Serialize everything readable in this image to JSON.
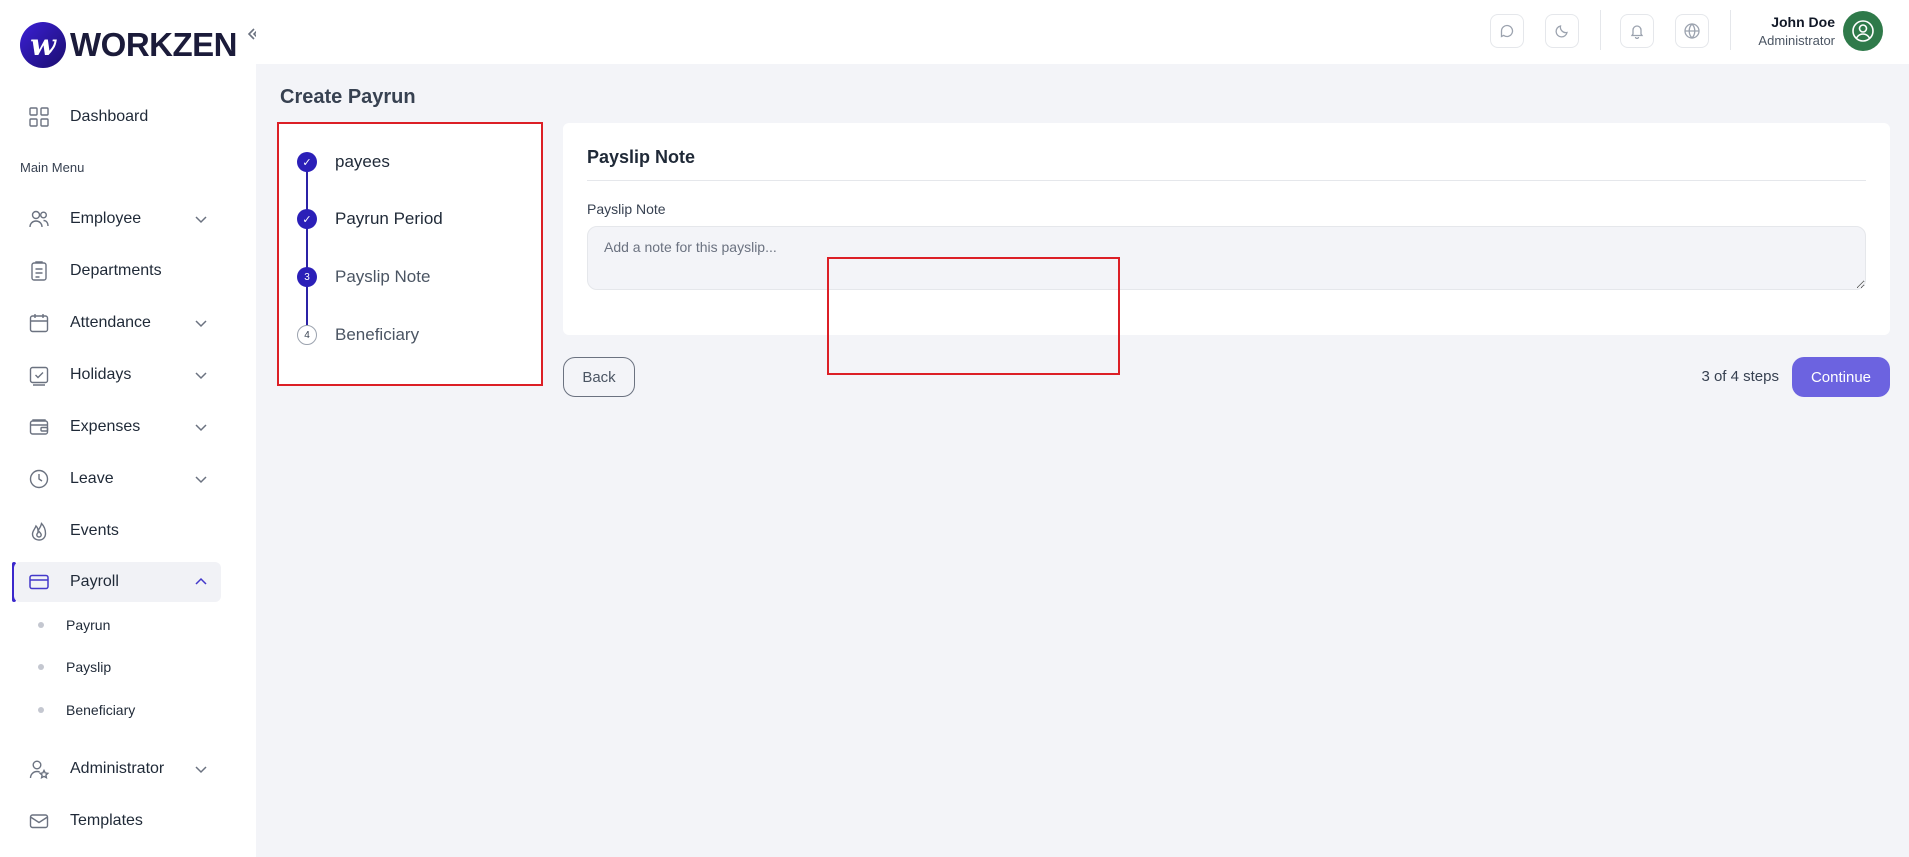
{
  "brand": {
    "logo_letter": "w",
    "name": "WORKZEN"
  },
  "sidebar": {
    "dashboard": "Dashboard",
    "menu_heading": "Main Menu",
    "items": {
      "employee": "Employee",
      "departments": "Departments",
      "attendance": "Attendance",
      "holidays": "Holidays",
      "expenses": "Expenses",
      "leave": "Leave",
      "events": "Events",
      "payroll": "Payroll",
      "administrator": "Administrator",
      "templates": "Templates"
    },
    "payroll_sub": {
      "payrun": "Payrun",
      "payslip": "Payslip",
      "beneficiary": "Beneficiary"
    },
    "active_item": "Payroll"
  },
  "header": {
    "user_name": "John Doe",
    "user_role": "Administrator"
  },
  "page": {
    "title": "Create Payrun",
    "steps": [
      {
        "label": "payees",
        "status": "done",
        "marker": "✓"
      },
      {
        "label": "Payrun Period",
        "status": "done",
        "marker": "✓"
      },
      {
        "label": "Payslip Note",
        "status": "current",
        "marker": "3"
      },
      {
        "label": "Beneficiary",
        "status": "pending",
        "marker": "4"
      }
    ],
    "card_title": "Payslip Note",
    "field_label": "Payslip Note",
    "field_placeholder": "Add a note for this payslip...",
    "field_value": "",
    "back_label": "Back",
    "steps_count": "3 of 4 steps",
    "continue_label": "Continue"
  },
  "colors": {
    "accent": "#2b1fb8",
    "continue": "#6c63e0",
    "highlight": "#dc1f26",
    "main_bg": "#f3f4f8"
  }
}
